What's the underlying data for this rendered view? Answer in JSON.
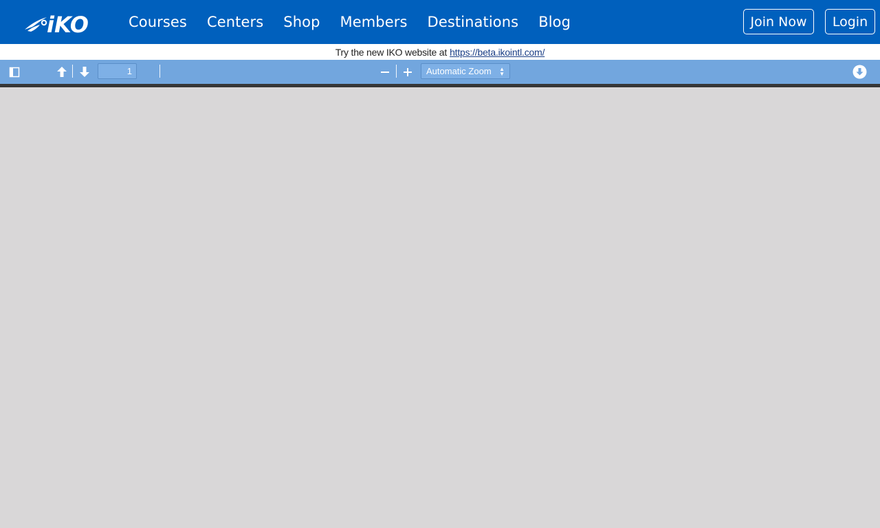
{
  "nav": {
    "links": [
      "Courses",
      "Centers",
      "Shop",
      "Members",
      "Destinations",
      "Blog"
    ],
    "join_label": "Join Now",
    "login_label": "Login",
    "brand_color": "#0060bd"
  },
  "notice": {
    "text": "Try the new IKO website at",
    "link_text": "https://beta.ikointl.com/"
  },
  "pdf_toolbar": {
    "page_number": "1",
    "zoom_label": "Automatic Zoom",
    "icons": [
      "sidebar-toggle-icon",
      "page-up-icon",
      "page-down-icon",
      "zoom-out-icon",
      "zoom-in-icon",
      "download-icon"
    ]
  }
}
